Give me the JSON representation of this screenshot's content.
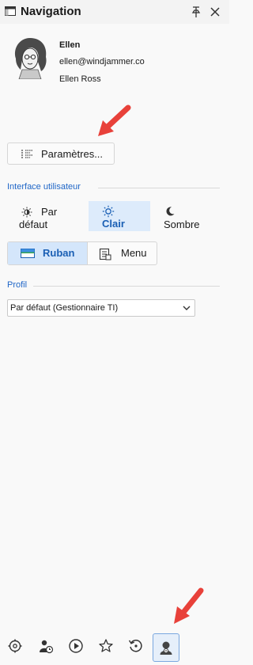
{
  "window": {
    "title": "Navigation"
  },
  "user": {
    "name": "Ellen",
    "email": "ellen@windjammer.co",
    "full_name": "Ellen Ross"
  },
  "settings_button": {
    "label": "Paramètres..."
  },
  "ui_section": {
    "title": "Interface utilisateur",
    "themes": [
      {
        "label_line1": "Par",
        "label_line2": "défaut",
        "icon": "sun-half-icon",
        "selected": false
      },
      {
        "label": "Clair",
        "icon": "sun-icon",
        "selected": true
      },
      {
        "label": "Sombre",
        "icon": "moon-icon",
        "selected": false
      }
    ],
    "layout_modes": [
      {
        "label": "Ruban",
        "icon": "ribbon-icon",
        "selected": true
      },
      {
        "label": "Menu",
        "icon": "menu-icon",
        "selected": false
      }
    ]
  },
  "profile_section": {
    "title": "Profil",
    "selected_profile": "Par défaut (Gestionnaire TI)"
  },
  "bottom_bar": {
    "icons": [
      "settings-icon",
      "user-clock-icon",
      "play-icon",
      "star-icon",
      "history-icon",
      "user-settings-icon"
    ],
    "selected_index": 5
  },
  "colors": {
    "accent": "#1f66c7",
    "selected_bg": "#ddebfb",
    "arrow": "#e8413a"
  }
}
